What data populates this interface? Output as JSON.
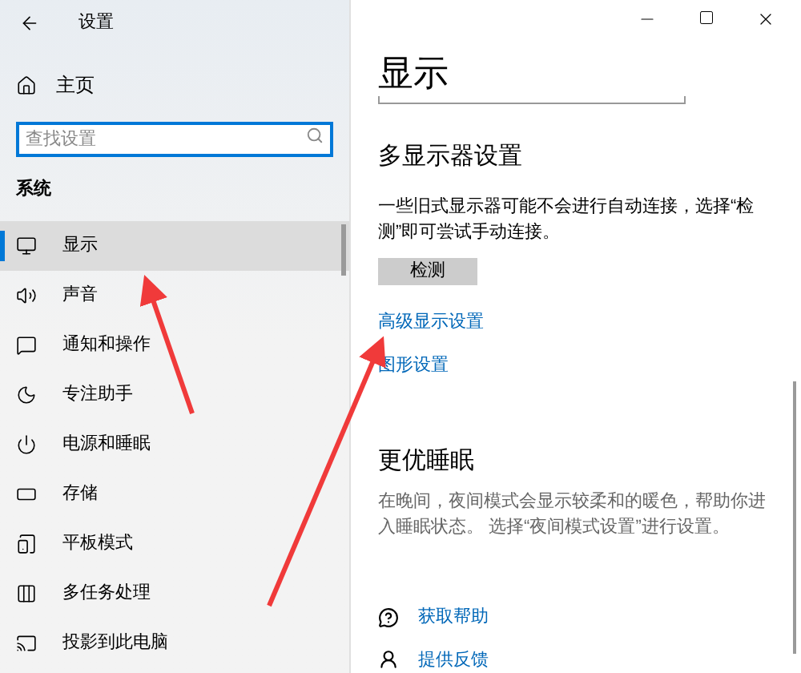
{
  "window": {
    "title": "设置"
  },
  "sidebar": {
    "home": "主页",
    "search": {
      "placeholder": "查找设置"
    },
    "section": "系统",
    "items": [
      {
        "label": "显示",
        "selected": true
      },
      {
        "label": "声音",
        "selected": false
      },
      {
        "label": "通知和操作",
        "selected": false
      },
      {
        "label": "专注助手",
        "selected": false
      },
      {
        "label": "电源和睡眠",
        "selected": false
      },
      {
        "label": "存储",
        "selected": false
      },
      {
        "label": "平板模式",
        "selected": false
      },
      {
        "label": "多任务处理",
        "selected": false
      },
      {
        "label": "投影到此电脑",
        "selected": false
      }
    ]
  },
  "content": {
    "title": "显示",
    "multi_display": {
      "heading": "多显示器设置",
      "description": "一些旧式显示器可能不会进行自动连接，选择“检测”即可尝试手动连接。",
      "button": "检测"
    },
    "links": [
      "高级显示设置",
      "图形设置"
    ],
    "sleep": {
      "heading": "更优睡眠",
      "description": "在晚间，夜间模式会显示较柔和的暖色，帮助你进入睡眠状态。 选择“夜间模式设置”进行设置。"
    },
    "help": [
      "获取帮助",
      "提供反馈"
    ]
  }
}
